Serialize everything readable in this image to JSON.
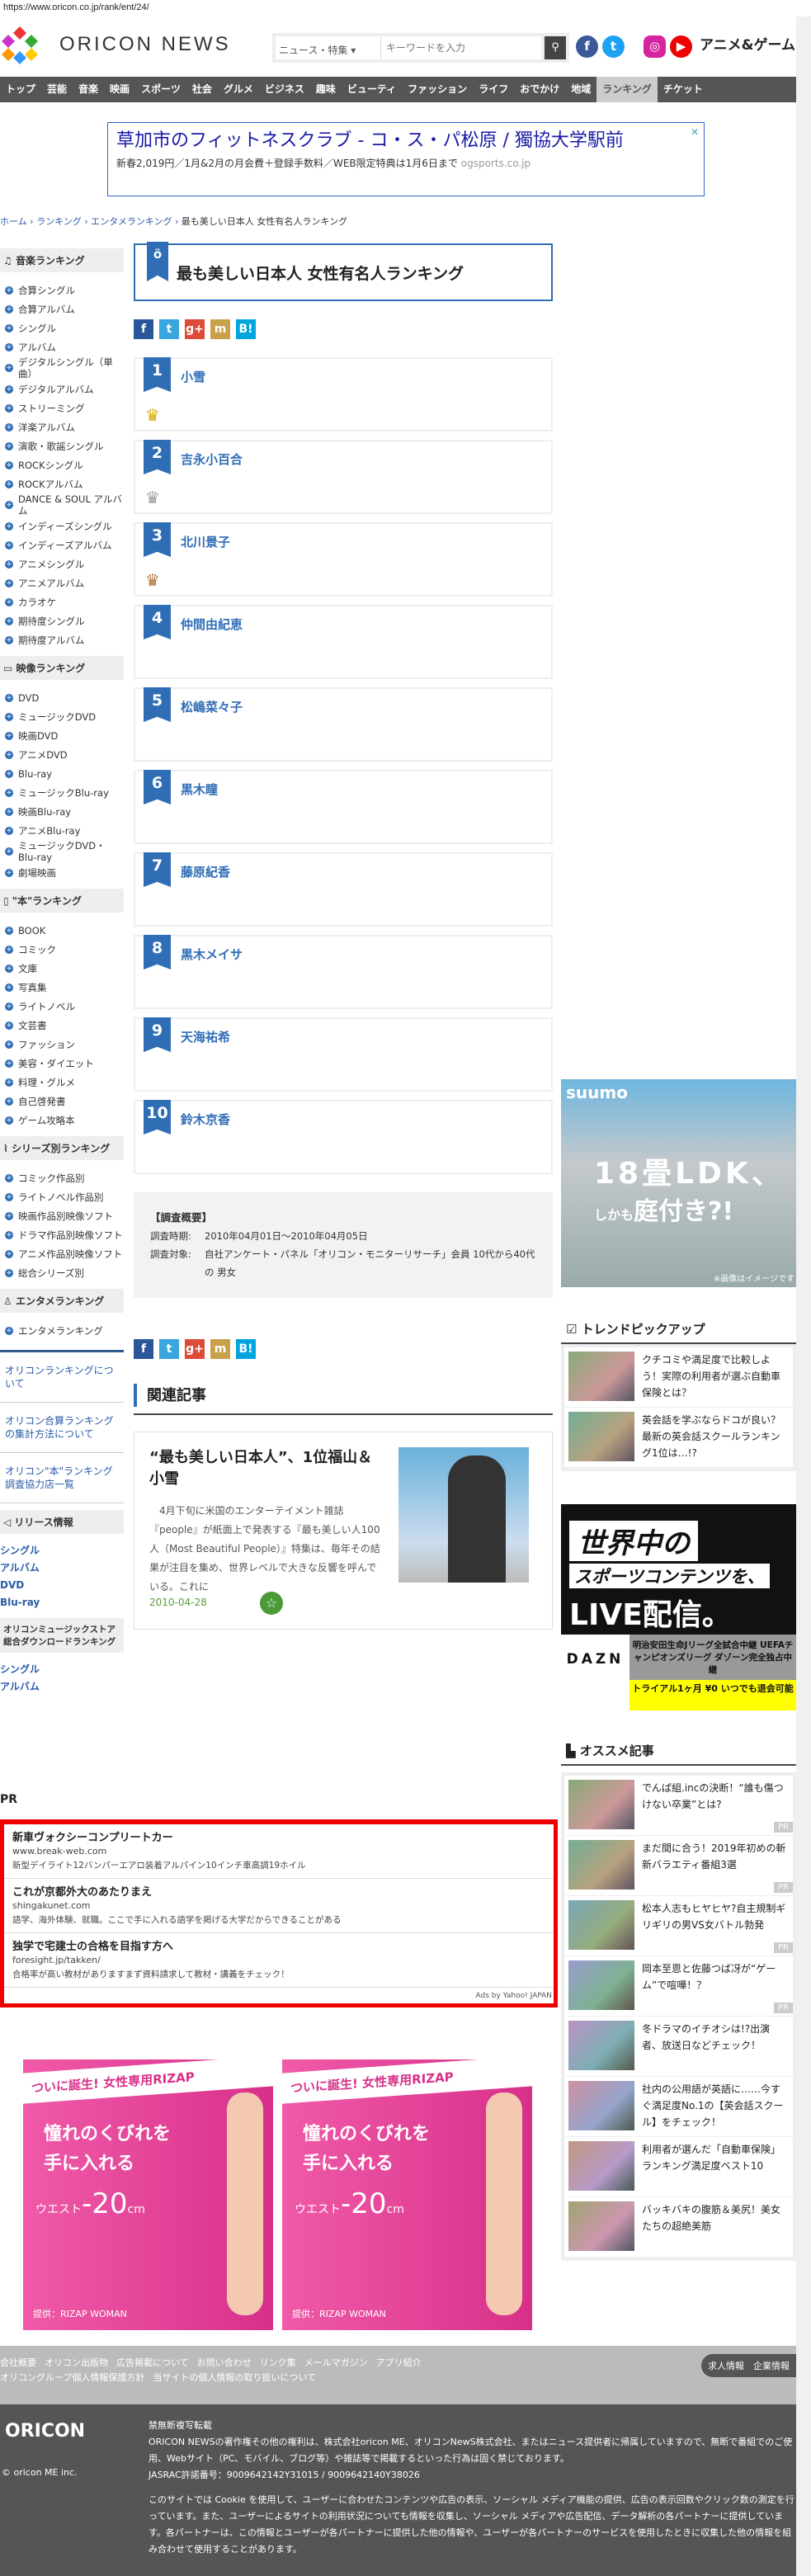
{
  "url": "https://www.oricon.co.jp/rank/ent/24/",
  "header": {
    "brand": "ORICON NEWS",
    "search_category": "ニュース・特集 ▾",
    "search_placeholder": "キーワードを入力",
    "anime_game": "アニメ&ゲーム"
  },
  "nav": [
    "トップ",
    "芸能",
    "音楽",
    "映画",
    "スポーツ",
    "社会",
    "グルメ",
    "ビジネス",
    "趣味",
    "ビューティ",
    "ファッション",
    "ライフ",
    "おでかけ",
    "地域",
    "ランキング",
    "チケット"
  ],
  "top_ad": {
    "title": "草加市のフィットネスクラブ - コ・ス・パ松原 / 獨協大学駅前",
    "desc": "新春2,019円／1月&2月の月会費＋登録手数料／WEB限定特典は1月6日まで",
    "domain": "ogsports.co.jp"
  },
  "breadcrumb": [
    "ホーム",
    "ランキング",
    "エンタメランキング",
    "最も美しい日本人 女性有名人ランキング"
  ],
  "sidebar": {
    "music": {
      "title": "音楽ランキング",
      "items": [
        "合算シングル",
        "合算アルバム",
        "シングル",
        "アルバム",
        "デジタルシングル（単曲）",
        "デジタルアルバム",
        "ストリーミング",
        "洋楽アルバム",
        "演歌・歌謡シングル",
        "ROCKシングル",
        "ROCKアルバム",
        "DANCE & SOUL アルバム",
        "インディーズシングル",
        "インディーズアルバム",
        "アニメシングル",
        "アニメアルバム",
        "カラオケ",
        "期待度シングル",
        "期待度アルバム"
      ]
    },
    "video": {
      "title": "映像ランキング",
      "items": [
        "DVD",
        "ミュージックDVD",
        "映画DVD",
        "アニメDVD",
        "Blu-ray",
        "ミュージックBlu-ray",
        "映画Blu-ray",
        "アニメBlu-ray",
        "ミュージックDVD・Blu-ray",
        "劇場映画"
      ]
    },
    "book": {
      "title": "\"本\"ランキング",
      "items": [
        "BOOK",
        "コミック",
        "文庫",
        "写真集",
        "ライトノベル",
        "文芸書",
        "ファッション",
        "美容・ダイエット",
        "料理・グルメ",
        "自己啓発書",
        "ゲーム攻略本"
      ]
    },
    "series": {
      "title": "シリーズ別ランキング",
      "items": [
        "コミック作品別",
        "ライトノベル作品別",
        "映画作品別映像ソフト",
        "ドラマ作品別映像ソフト",
        "アニメ作品別映像ソフト",
        "総合シリーズ別"
      ]
    },
    "ent": {
      "title": "エンタメランキング",
      "items": [
        "エンタメランキング"
      ]
    },
    "links": [
      "オリコンランキングについて",
      "オリコン合算ランキングの集計方法について",
      "オリコン\"本\"ランキング調査協力店一覧"
    ],
    "release": {
      "title": "リリース情報",
      "items": [
        "シングル",
        "アルバム",
        "DVD",
        "Blu-ray"
      ]
    },
    "store": {
      "title": "オリコンミュージックストア総合ダウンロードランキング",
      "items": [
        "シングル",
        "アルバム"
      ]
    }
  },
  "main": {
    "title": "最も美しい日本人 女性有名人ランキング",
    "share": [
      "f",
      "t",
      "g+",
      "m",
      "B!"
    ],
    "ranks": [
      {
        "n": "1",
        "name": "小雪",
        "crown": "gold"
      },
      {
        "n": "2",
        "name": "吉永小百合",
        "crown": "silver"
      },
      {
        "n": "3",
        "name": "北川景子",
        "crown": "bronze"
      },
      {
        "n": "4",
        "name": "仲間由紀恵"
      },
      {
        "n": "5",
        "name": "松嶋菜々子"
      },
      {
        "n": "6",
        "name": "黒木瞳"
      },
      {
        "n": "7",
        "name": "藤原紀香"
      },
      {
        "n": "8",
        "name": "黒木メイサ"
      },
      {
        "n": "9",
        "name": "天海祐希"
      },
      {
        "n": "10",
        "name": "鈴木京香"
      }
    ],
    "survey": {
      "heading": "【調査概要】",
      "period_label": "調査時期:",
      "period": "2010年04月01日～2010年04月05日",
      "target_label": "調査対象:",
      "target": "自社アンケート・パネル「オリコン・モニターリサーチ」会員 10代から40代 の 男女"
    },
    "related_heading": "関連記事",
    "article": {
      "title": "“最も美しい日本人”、1位福山＆小雪",
      "excerpt": "4月下旬に米国のエンターテイメント雑誌『people』が紙面上で発表する『最も美しい人100人（Most Beautiful People）』特集は、毎年その結果が注目を集め、世界レベルで大きな反響を呼んでいる。これに",
      "date": "2010-04-28"
    }
  },
  "pr": {
    "label": "PR",
    "ads": [
      {
        "title": "新車ヴォクシーコンプリートカー",
        "url": "www.break-web.com",
        "desc": "新型デイライト12バンパーエアロ装着アルパイン10インチ車高調19ホイル"
      },
      {
        "title": "これが京都外大のあたりまえ",
        "url": "shingakunet.com",
        "desc": "語学、海外体験、就職。ここで手に入れる語学を掲げる大学だからできることがある"
      },
      {
        "title": "独学で宅建士の合格を目指す方へ",
        "url": "foresight.jp/takken/",
        "desc": "合格率が高い教材がありますまず資料請求して教材・講義をチェック！"
      }
    ],
    "credit": "Ads by Yahoo! JAPAN"
  },
  "rizap": {
    "top": "ついに誕生! 女性専用RIZAP",
    "main": "憧れのくびれを手に入れる",
    "waist": "ウエスト",
    "num": "-20",
    "unit": "cm",
    "credit": "提供：RIZAP WOMAN"
  },
  "right": {
    "suumo": {
      "logo": "suumo",
      "h1": "18畳LDK、",
      "h2a": "しかも",
      "h2b": "庭付き?!",
      "note": "※画像はイメージです"
    },
    "trend_heading": "トレンドピックアップ",
    "trend": [
      "クチコミや満足度で比較しよう！実際の利用者が選ぶ自動車保険とは？",
      "英会話を学ぶならドコが良い？最新の英会話スクールランキング1位は…!?"
    ],
    "dazn": {
      "a": "世界中の",
      "b": "スポーツコンテンツを、",
      "c": "LIVE配信。",
      "logo": "DAZN",
      "g": "明治安田生命Jリーグ全試合中継 UEFAチャンピオンズリーグ ダゾーン完全独占中継",
      "y": "トライアル1ヶ月 ¥0 いつでも退会可能"
    },
    "rec_heading": "オススメ記事",
    "rec": [
      {
        "t": "でんぱ組.incの決断！“誰も傷つけない卒業”とは?",
        "pr": "PR"
      },
      {
        "t": "まだ間に合う！2019年初めの斬新バラエティ番組3選",
        "pr": "PR"
      },
      {
        "t": "松本人志もヒヤヒヤ?自主規制ギリギリの男VS女バトル勃発",
        "pr": "PR"
      },
      {
        "t": "岡本至恩と佐藤つば冴が“ゲーム”で喧嘩！？",
        "pr": "PR"
      },
      {
        "t": "冬ドラマのイチオシは!?出演者、放送日などチェック！"
      },
      {
        "t": "社内の公用語が英語に……今すぐ満足度No.1の【英会話スクール】をチェック！"
      },
      {
        "t": "利用者が選んだ「自動車保険」ランキング満足度ベスト10"
      },
      {
        "t": "バッキバキの腹筋＆美尻！美女たちの超絶美筋"
      }
    ]
  },
  "footer": {
    "links1": [
      "会社概要",
      "オリコン出版物",
      "広告掲載について",
      "お問い合わせ",
      "リンク集",
      "メールマガジン",
      "アプリ紹介"
    ],
    "links2": [
      "オリコングループ個人情報保護方針",
      "当サイトの個人情報の取り扱いについて"
    ],
    "jobs": "求人情報",
    "corp": "企業情報",
    "logo": "ORICON",
    "copyright": "© oricon ME inc.",
    "notice_title": "禁無断複写転載",
    "notice": "ORICON NEWSの著作権その他の権利は、株式会社oricon ME、オリコンNewS株式会社、またはニュース提供者に帰属していますので、無断で番組でのご使用、Webサイト（PC、モバイル、ブログ等）や雑誌等で掲載するといった行為は固く禁じております。",
    "jasrac": "JASRAC許諾番号：9009642142Y31015 / 9009642140Y38026",
    "cookie": "このサイトでは Cookie を使用して、ユーザーに合わせたコンテンツや広告の表示、ソーシャル メディア機能の提供、広告の表示回数やクリック数の測定を行っています。また、ユーザーによるサイトの利用状況についても情報を収集し、ソーシャル メディアや広告配信、データ解析の各パートナーに提供しています。各パートナーは、この情報とユーザーが各パートナーに提供した他の情報や、ユーザーが各パートナーのサービスを使用したときに収集した他の情報を組み合わせて使用することがあります。"
  }
}
